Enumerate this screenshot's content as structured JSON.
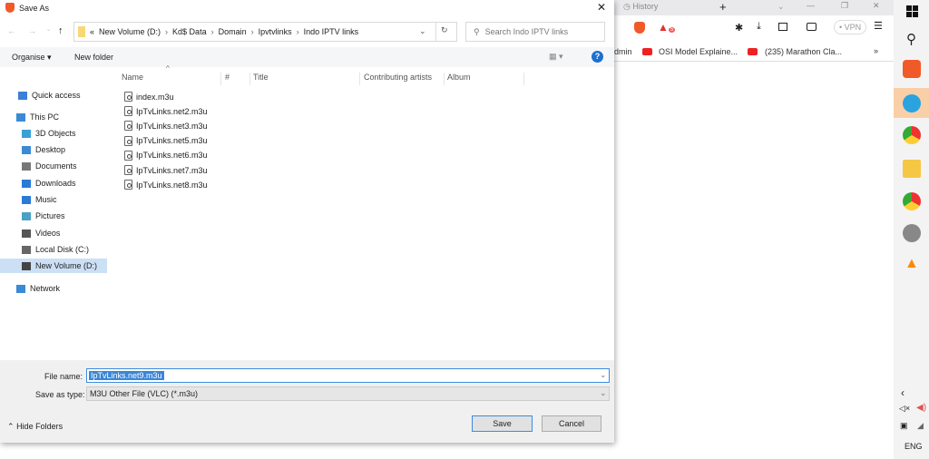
{
  "dialog": {
    "title": "Save As",
    "breadcrumb": [
      "«",
      "New Volume (D:)",
      "Kd$ Data",
      "Domain",
      "Ipvtvlinks",
      "Indo IPTV links"
    ],
    "search_placeholder": "Search Indo IPTV links",
    "organise": "Organise ▾",
    "new_folder": "New folder",
    "columns": [
      "Name",
      "#",
      "Title",
      "Contributing artists",
      "Album"
    ],
    "sidebar": [
      {
        "label": "Quick access",
        "icon": "star-icon",
        "color": "#3b7fd6"
      },
      {
        "label": "This PC",
        "icon": "computer-icon",
        "color": "#3a8ad6"
      },
      {
        "label": "3D Objects",
        "icon": "cube-icon",
        "color": "#3aa0d6"
      },
      {
        "label": "Desktop",
        "icon": "desktop-icon",
        "color": "#3a8ad6"
      },
      {
        "label": "Documents",
        "icon": "document-icon",
        "color": "#777"
      },
      {
        "label": "Downloads",
        "icon": "download-icon",
        "color": "#2a7ad6"
      },
      {
        "label": "Music",
        "icon": "music-icon",
        "color": "#2a7ad6"
      },
      {
        "label": "Pictures",
        "icon": "picture-icon",
        "color": "#4aa0c6"
      },
      {
        "label": "Videos",
        "icon": "video-icon",
        "color": "#555"
      },
      {
        "label": "Local Disk (C:)",
        "icon": "drive-icon",
        "color": "#666"
      },
      {
        "label": "New Volume (D:)",
        "icon": "drive-icon",
        "color": "#444",
        "selected": true
      },
      {
        "label": "Network",
        "icon": "network-icon",
        "color": "#3a8ad6"
      }
    ],
    "files": [
      "index.m3u",
      "IpTvLinks.net2.m3u",
      "IpTvLinks.net3.m3u",
      "IpTvLinks.net5.m3u",
      "IpTvLinks.net6.m3u",
      "IpTvLinks.net7.m3u",
      "IpTvLinks.net8.m3u"
    ],
    "file_name_label": "File name:",
    "file_name": "IpTvLinks.net9.m3u",
    "save_type_label": "Save as type:",
    "save_type": "M3U Other File (VLC) (*.m3u)",
    "hide_folders": "Hide Folders",
    "save": "Save",
    "cancel": "Cancel"
  },
  "browser": {
    "tab": "History",
    "vpn": "• VPN",
    "bookmarks": [
      "dmin",
      "OSI Model Explaine...",
      "(235) Marathon Cla..."
    ],
    "badge": "5"
  },
  "taskbar": {
    "lang": "ENG"
  }
}
